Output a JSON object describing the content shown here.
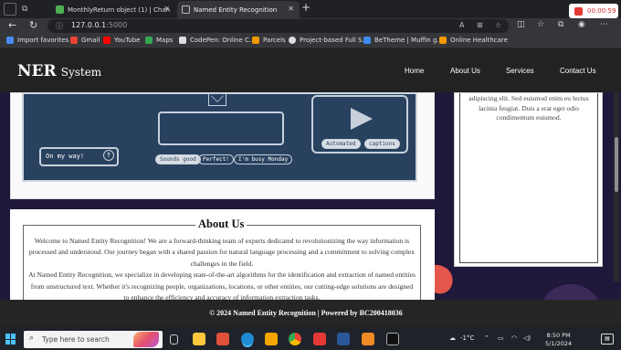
{
  "browser": {
    "tabs": [
      {
        "title": "MonthlyReturn object (1) | Chan"
      },
      {
        "title": "Named Entity Recognition"
      }
    ],
    "new_tab_symbol": "+",
    "close_symbol": "✕",
    "recording_time": "00:00:59",
    "address": {
      "host": "127.0.0.1",
      "port": ":5000"
    },
    "bookmarks": [
      {
        "label": "Import favorites",
        "color": "#4a8df6"
      },
      {
        "label": "Gmail",
        "color": "#ea4335"
      },
      {
        "label": "YouTube",
        "color": "#ff0000"
      },
      {
        "label": "Maps",
        "color": "#34a853"
      },
      {
        "label": "CodePen: Online C...",
        "color": "#dddddd"
      },
      {
        "label": "Parcels",
        "color": "#f29900"
      },
      {
        "label": "Project-based Full S...",
        "color": "#dddddd"
      },
      {
        "label": "BeTheme | Muffin g...",
        "color": "#3f8cf3"
      },
      {
        "label": "Online Healthcare",
        "color": "#f29900"
      }
    ]
  },
  "site": {
    "brand_big": "NER",
    "brand_small": "System",
    "nav": [
      "Home",
      "About Us",
      "Services",
      "Contact Us"
    ],
    "illustration": {
      "message": "On my way!",
      "pills": [
        "Sounds good",
        "Perfect!",
        "I'm busy Monday"
      ],
      "tags": [
        "Automated",
        "captions"
      ]
    },
    "sidebar_text": "adipiscing elit. Sed euismod enim eu lectus lacinia feugiat. Duis a erat eget odio condimentum euismod.",
    "about": {
      "title": "About Us",
      "p1": "Welcome to Named Entity Recognition! We are a forward-thinking team of experts dedicated to revolutionizing the way information is processed and understood. Our journey began with a shared passion for natural language processing and a commitment to solving complex challenges in the field.",
      "p2": "At Named Entity Recognition, we specialize in developing state-of-the-art algorithms for the identification and extraction of named entities from unstructured text. Whether it's recognizing people, organizations, locations, or other entities, our cutting-edge solutions are designed to enhance the efficiency and accuracy of information extraction tasks."
    },
    "footer": "© 2024 Named Entity Recognition | Powered by BC200418036"
  },
  "taskbar": {
    "search_placeholder": "Type here to search",
    "weather": "-1°C",
    "time": "8:50 PM",
    "date": "5/1/2024"
  }
}
